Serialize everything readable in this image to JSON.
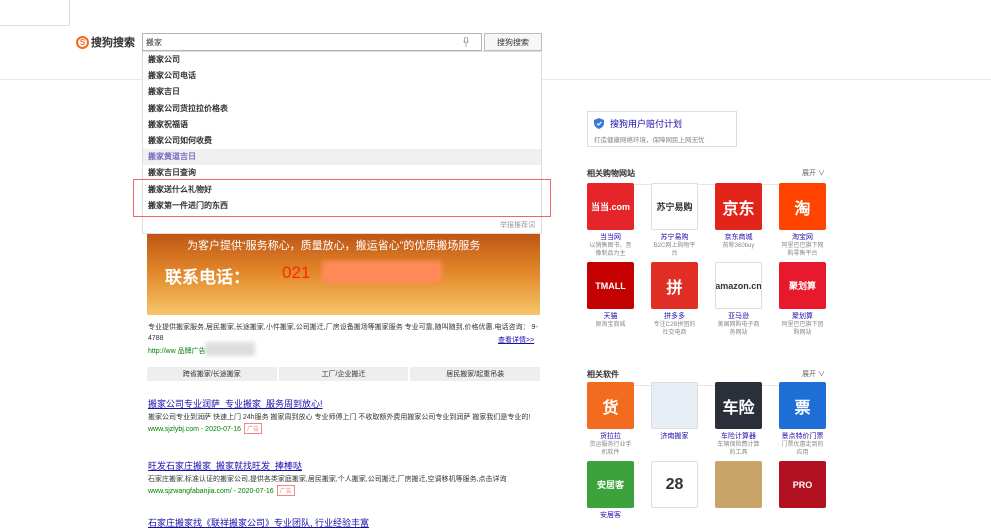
{
  "logo": {
    "text": "搜狗搜索"
  },
  "search": {
    "value": "搬家",
    "button": "搜狗搜索"
  },
  "suggestions": [
    "搬家公司",
    "搬家公司电话",
    "搬家吉日",
    "搬家公司货拉拉价格表",
    "搬家祝福语",
    "搬家公司如何收费",
    "搬家黄道吉日",
    "搬家吉日查询",
    "搬家送什么礼物好",
    "搬家第一件进门的东西"
  ],
  "suggest_report": "举报推荐词",
  "banner": {
    "slogan": "为客户提供“服务称心，质量放心，搬运省心”的优质搬场服务",
    "phone_label": "联系电话：",
    "phone": "021"
  },
  "ad": {
    "desc": "专业提供搬家服务,居民搬家,长途搬家,小件搬家,公司搬迁,厂房设备搬场等搬家服务 专业可靠,随叫随到,价格优惠.电话咨询：             9-4788",
    "detail": "查看详情>>",
    "url": "http://ww                        品牌广告",
    "tabs": [
      "跨省搬家/长途搬家",
      "工厂/企业搬迁",
      "居民搬家/起重吊装"
    ]
  },
  "results": [
    {
      "title": "搬家公司专业润萨_专业搬家_服务周到放心!",
      "snippet": "搬家公司专业到润萨 快速上门 24h服务 搬家周到放心 专业师傅上门 不收取额外费用搬家公司专业到润萨 搬家我们是专业的!",
      "url": "www.sjzlybj.com - 2020-07-16",
      "tag": "广告"
    },
    {
      "title": "旺发石家庄搬家_搬家就找旺发_捧棒哒",
      "snippet": "石家庄搬家,标准认证的搬家公司,提供各类家庭搬家,居民搬家,个人搬家,公司搬迁,厂房搬迁,空调移机等服务,点击详询",
      "url": "www.sjzwangfabanjia.com/ - 2020-07-16",
      "tag": "广告"
    },
    {
      "title": "石家庄搬家找《联祥搬家公司》专业团队, 行业经验丰富",
      "snippet": "",
      "url": "",
      "tag": ""
    }
  ],
  "right": {
    "plan": {
      "title": "搜狗用户赔付计划",
      "sub": "打造健康网络环境，保障网民上网无忧"
    },
    "shopping": {
      "title": "相关购物网站",
      "more": "展开",
      "items": [
        {
          "name": "当当网",
          "desc": "以销售图书、音像制品为主",
          "logo": "当当.com",
          "color": "#e6252a"
        },
        {
          "name": "苏宁易购",
          "desc": "B2C网上购物平台",
          "logo": "苏宁易购",
          "color": "#ffffff"
        },
        {
          "name": "京东商城",
          "desc": "前称360buy",
          "logo": "京东",
          "color": "#e1251b"
        },
        {
          "name": "淘宝网",
          "desc": "阿里巴巴旗下网购零售平台",
          "logo": "淘",
          "color": "#ff4400"
        },
        {
          "name": "天猫",
          "desc": "原淘宝商城",
          "logo": "TMALL",
          "color": "#c40000"
        },
        {
          "name": "拼多多",
          "desc": "专注C2B拼团的社交电商",
          "logo": "拼",
          "color": "#e02e24"
        },
        {
          "name": "亚马逊",
          "desc": "美国网购电子商务网站",
          "logo": "amazon.cn",
          "color": "#ffffff"
        },
        {
          "name": "聚划算",
          "desc": "阿里巴巴旗下团购网站",
          "logo": "聚划算",
          "color": "#e8192c"
        }
      ]
    },
    "software": {
      "title": "相关软件",
      "more": "展开",
      "items": [
        {
          "name": "货拉拉",
          "desc": "货运服务行业手机软件",
          "logo": "货",
          "color": "#f26b1f"
        },
        {
          "name": "济南搬家",
          "desc": "",
          "logo": "",
          "color": "#e8eef6"
        },
        {
          "name": "车险计算器",
          "desc": "车辆保险费计算的工具",
          "logo": "车险",
          "color": "#2a2f3a"
        },
        {
          "name": "景点特价门票",
          "desc": "门票优惠走到的应用",
          "logo": "票",
          "color": "#1d6fd6"
        },
        {
          "name": "安居客",
          "desc": "",
          "logo": "安居客",
          "color": "#3ca33c"
        },
        {
          "name": "",
          "desc": "",
          "logo": "28",
          "color": "#ffffff"
        },
        {
          "name": "",
          "desc": "",
          "logo": "",
          "color": "#c9a46a"
        },
        {
          "name": "",
          "desc": "",
          "logo": "PRO",
          "color": "#b01020"
        }
      ]
    }
  }
}
